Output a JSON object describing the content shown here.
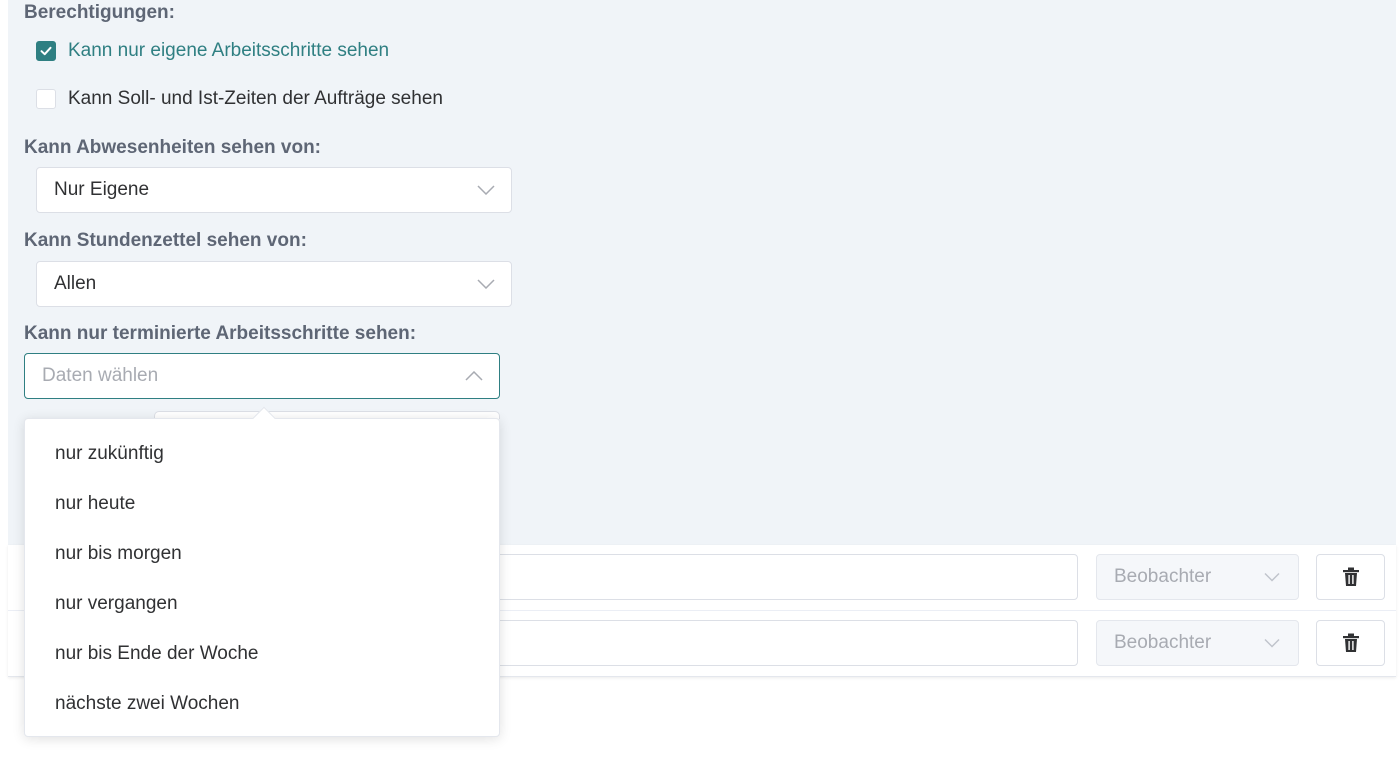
{
  "permissions": {
    "heading": "Berechtigungen:",
    "checkboxes": [
      {
        "label": "Kann nur eigene Arbeitsschritte sehen",
        "checked": true
      },
      {
        "label": "Kann Soll- und Ist-Zeiten der Aufträge sehen",
        "checked": false
      }
    ]
  },
  "absences": {
    "label": "Kann Abwesenheiten sehen von:",
    "selected": "Nur Eigene"
  },
  "timesheets": {
    "label": "Kann Stundenzettel sehen von:",
    "selected": "Allen"
  },
  "scheduled_steps": {
    "label": "Kann nur terminierte Arbeitsschritte sehen:",
    "placeholder": "Daten wählen",
    "options": [
      "nur zukünftig",
      "nur heute",
      "nur bis morgen",
      "nur vergangen",
      "nur bis Ende der Woche",
      "nächste zwei Wochen"
    ]
  },
  "members": [
    {
      "role": "Beobachter"
    },
    {
      "role": "Beobachter"
    }
  ],
  "colors": {
    "accent": "#2f7f82",
    "panel_bg": "#f0f4f8",
    "label": "#5e6675"
  }
}
